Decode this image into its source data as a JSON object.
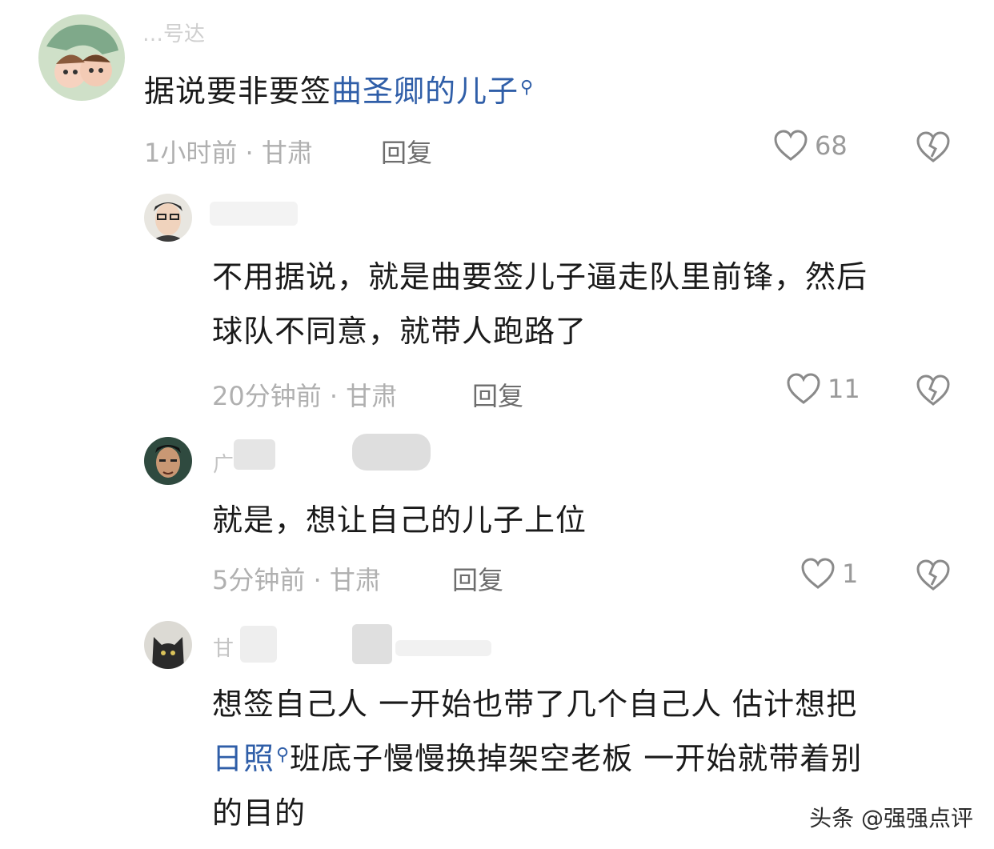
{
  "comments": [
    {
      "username": "…号达",
      "text_plain": "据说要非要签",
      "link_text": "曲圣卿的儿子",
      "meta": "1小时前 · 甘肃",
      "reply": "回复",
      "likes": "68"
    },
    {
      "username": "",
      "line1": "不用据说，就是曲要签儿子逼走队里前锋，然后",
      "line2": "球队不同意，就带人跑路了",
      "meta": "20分钟前 · 甘肃",
      "reply": "回复",
      "likes": "11"
    },
    {
      "username": "广",
      "line1": "就是，想让自己的儿子上位",
      "meta": "5分钟前 · 甘肃",
      "reply": "回复",
      "likes": "1"
    },
    {
      "username": "甘",
      "line1": "想签自己人 一开始也带了几个自己人 估计想把",
      "link_text": "日照",
      "line2_rest": "班底子慢慢换掉架空老板 一开始就带着别",
      "line3": "的目的"
    }
  ],
  "watermark": "头条 @强强点评",
  "colors": {
    "link": "#2f5ea8",
    "meta": "#b0b0b0",
    "reply": "#6d6d6d"
  },
  "icons": [
    "search-icon",
    "heart-icon",
    "broken-heart-icon",
    "avatar-image"
  ]
}
